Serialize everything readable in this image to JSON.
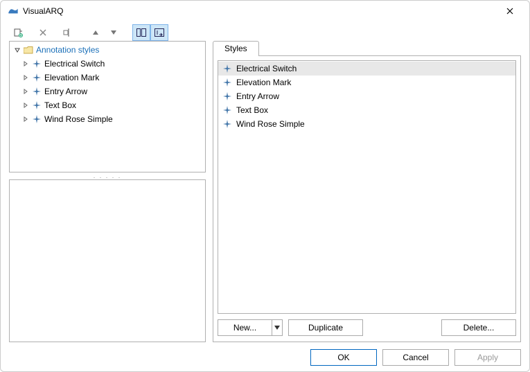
{
  "window": {
    "title": "VisualARQ"
  },
  "toolbar": {
    "new_doc": "new-document-icon",
    "delete": "delete-icon",
    "rename": "rename-icon",
    "move_up": "move-up-icon",
    "move_down": "move-down-icon",
    "view_panels": "panels-view-icon",
    "view_wizard": "wizard-view-icon"
  },
  "tree": {
    "root_label": "Annotation styles",
    "children": [
      {
        "label": "Electrical Switch"
      },
      {
        "label": "Elevation Mark"
      },
      {
        "label": "Entry Arrow"
      },
      {
        "label": "Text Box"
      },
      {
        "label": "Wind Rose Simple"
      }
    ]
  },
  "styles": {
    "tab_label": "Styles",
    "items": [
      {
        "label": "Electrical Switch",
        "selected": true
      },
      {
        "label": "Elevation Mark",
        "selected": false
      },
      {
        "label": "Entry Arrow",
        "selected": false
      },
      {
        "label": "Text Box",
        "selected": false
      },
      {
        "label": "Wind Rose Simple",
        "selected": false
      }
    ],
    "buttons": {
      "new": "New...",
      "duplicate": "Duplicate",
      "delete": "Delete..."
    }
  },
  "footer": {
    "ok": "OK",
    "cancel": "Cancel",
    "apply": "Apply"
  }
}
